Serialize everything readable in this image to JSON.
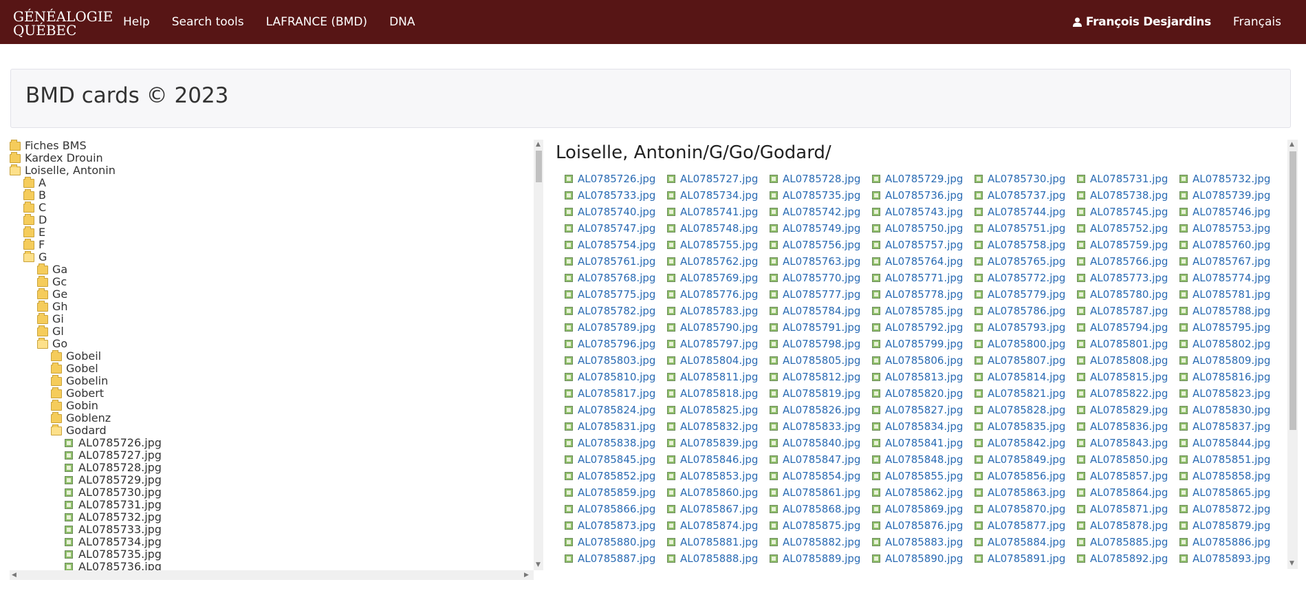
{
  "nav": {
    "logo_line1": "GÉNÉALOGIE",
    "logo_line2": "QUÉBEC",
    "links": [
      "Help",
      "Search tools",
      "LAFRANCE (BMD)",
      "DNA"
    ],
    "user_name": "François Desjardins",
    "user_icon": "user-icon",
    "language": "Français"
  },
  "page_title": "BMD cards © 2023",
  "tree": [
    {
      "label": "Fiches BMS",
      "level": 0,
      "type": "folder",
      "open": false
    },
    {
      "label": "Kardex Drouin",
      "level": 0,
      "type": "folder",
      "open": false
    },
    {
      "label": "Loiselle, Antonin",
      "level": 0,
      "type": "folder",
      "open": true
    },
    {
      "label": "A",
      "level": 1,
      "type": "folder",
      "open": false
    },
    {
      "label": "B",
      "level": 1,
      "type": "folder",
      "open": false
    },
    {
      "label": "C",
      "level": 1,
      "type": "folder",
      "open": false
    },
    {
      "label": "D",
      "level": 1,
      "type": "folder",
      "open": false
    },
    {
      "label": "E",
      "level": 1,
      "type": "folder",
      "open": false
    },
    {
      "label": "F",
      "level": 1,
      "type": "folder",
      "open": false
    },
    {
      "label": "G",
      "level": 1,
      "type": "folder",
      "open": true
    },
    {
      "label": "Ga",
      "level": 2,
      "type": "folder",
      "open": false
    },
    {
      "label": "Gc",
      "level": 2,
      "type": "folder",
      "open": false
    },
    {
      "label": "Ge",
      "level": 2,
      "type": "folder",
      "open": false
    },
    {
      "label": "Gh",
      "level": 2,
      "type": "folder",
      "open": false
    },
    {
      "label": "Gi",
      "level": 2,
      "type": "folder",
      "open": false
    },
    {
      "label": "Gl",
      "level": 2,
      "type": "folder",
      "open": false
    },
    {
      "label": "Go",
      "level": 2,
      "type": "folder",
      "open": true
    },
    {
      "label": "Gobeil",
      "level": 3,
      "type": "folder",
      "open": false
    },
    {
      "label": "Gobel",
      "level": 3,
      "type": "folder",
      "open": false
    },
    {
      "label": "Gobelin",
      "level": 3,
      "type": "folder",
      "open": false
    },
    {
      "label": "Gobert",
      "level": 3,
      "type": "folder",
      "open": false
    },
    {
      "label": "Gobin",
      "level": 3,
      "type": "folder",
      "open": false
    },
    {
      "label": "Goblenz",
      "level": 3,
      "type": "folder",
      "open": false
    },
    {
      "label": "Godard",
      "level": 3,
      "type": "folder",
      "open": true
    },
    {
      "label": "AL0785726.jpg",
      "level": 4,
      "type": "file"
    },
    {
      "label": "AL0785727.jpg",
      "level": 4,
      "type": "file"
    },
    {
      "label": "AL0785728.jpg",
      "level": 4,
      "type": "file"
    },
    {
      "label": "AL0785729.jpg",
      "level": 4,
      "type": "file"
    },
    {
      "label": "AL0785730.jpg",
      "level": 4,
      "type": "file"
    },
    {
      "label": "AL0785731.jpg",
      "level": 4,
      "type": "file"
    },
    {
      "label": "AL0785732.jpg",
      "level": 4,
      "type": "file"
    },
    {
      "label": "AL0785733.jpg",
      "level": 4,
      "type": "file"
    },
    {
      "label": "AL0785734.jpg",
      "level": 4,
      "type": "file"
    },
    {
      "label": "AL0785735.jpg",
      "level": 4,
      "type": "file"
    },
    {
      "label": "AL0785736.jpg",
      "level": 4,
      "type": "file"
    }
  ],
  "folder_title": "Loiselle, Antonin/G/Go/Godard/",
  "files": [
    [
      "AL0785726.jpg",
      "AL0785727.jpg",
      "AL0785728.jpg",
      "AL0785729.jpg",
      "AL0785730.jpg",
      "AL0785731.jpg",
      "AL0785732.jpg"
    ],
    [
      "AL0785733.jpg",
      "AL0785734.jpg",
      "AL0785735.jpg",
      "AL0785736.jpg",
      "AL0785737.jpg",
      "AL0785738.jpg",
      "AL0785739.jpg"
    ],
    [
      "AL0785740.jpg",
      "AL0785741.jpg",
      "AL0785742.jpg",
      "AL0785743.jpg",
      "AL0785744.jpg",
      "AL0785745.jpg",
      "AL0785746.jpg"
    ],
    [
      "AL0785747.jpg",
      "AL0785748.jpg",
      "AL0785749.jpg",
      "AL0785750.jpg",
      "AL0785751.jpg",
      "AL0785752.jpg",
      "AL0785753.jpg"
    ],
    [
      "AL0785754.jpg",
      "AL0785755.jpg",
      "AL0785756.jpg",
      "AL0785757.jpg",
      "AL0785758.jpg",
      "AL0785759.jpg",
      "AL0785760.jpg"
    ],
    [
      "AL0785761.jpg",
      "AL0785762.jpg",
      "AL0785763.jpg",
      "AL0785764.jpg",
      "AL0785765.jpg",
      "AL0785766.jpg",
      "AL0785767.jpg"
    ],
    [
      "AL0785768.jpg",
      "AL0785769.jpg",
      "AL0785770.jpg",
      "AL0785771.jpg",
      "AL0785772.jpg",
      "AL0785773.jpg",
      "AL0785774.jpg"
    ],
    [
      "AL0785775.jpg",
      "AL0785776.jpg",
      "AL0785777.jpg",
      "AL0785778.jpg",
      "AL0785779.jpg",
      "AL0785780.jpg",
      "AL0785781.jpg"
    ],
    [
      "AL0785782.jpg",
      "AL0785783.jpg",
      "AL0785784.jpg",
      "AL0785785.jpg",
      "AL0785786.jpg",
      "AL0785787.jpg",
      "AL0785788.jpg"
    ],
    [
      "AL0785789.jpg",
      "AL0785790.jpg",
      "AL0785791.jpg",
      "AL0785792.jpg",
      "AL0785793.jpg",
      "AL0785794.jpg",
      "AL0785795.jpg"
    ],
    [
      "AL0785796.jpg",
      "AL0785797.jpg",
      "AL0785798.jpg",
      "AL0785799.jpg",
      "AL0785800.jpg",
      "AL0785801.jpg",
      "AL0785802.jpg"
    ],
    [
      "AL0785803.jpg",
      "AL0785804.jpg",
      "AL0785805.jpg",
      "AL0785806.jpg",
      "AL0785807.jpg",
      "AL0785808.jpg",
      "AL0785809.jpg"
    ],
    [
      "AL0785810.jpg",
      "AL0785811.jpg",
      "AL0785812.jpg",
      "AL0785813.jpg",
      "AL0785814.jpg",
      "AL0785815.jpg",
      "AL0785816.jpg"
    ],
    [
      "AL0785817.jpg",
      "AL0785818.jpg",
      "AL0785819.jpg",
      "AL0785820.jpg",
      "AL0785821.jpg",
      "AL0785822.jpg",
      "AL0785823.jpg"
    ],
    [
      "AL0785824.jpg",
      "AL0785825.jpg",
      "AL0785826.jpg",
      "AL0785827.jpg",
      "AL0785828.jpg",
      "AL0785829.jpg",
      "AL0785830.jpg"
    ],
    [
      "AL0785831.jpg",
      "AL0785832.jpg",
      "AL0785833.jpg",
      "AL0785834.jpg",
      "AL0785835.jpg",
      "AL0785836.jpg",
      "AL0785837.jpg"
    ],
    [
      "AL0785838.jpg",
      "AL0785839.jpg",
      "AL0785840.jpg",
      "AL0785841.jpg",
      "AL0785842.jpg",
      "AL0785843.jpg",
      "AL0785844.jpg"
    ],
    [
      "AL0785845.jpg",
      "AL0785846.jpg",
      "AL0785847.jpg",
      "AL0785848.jpg",
      "AL0785849.jpg",
      "AL0785850.jpg",
      "AL0785851.jpg"
    ],
    [
      "AL0785852.jpg",
      "AL0785853.jpg",
      "AL0785854.jpg",
      "AL0785855.jpg",
      "AL0785856.jpg",
      "AL0785857.jpg",
      "AL0785858.jpg"
    ],
    [
      "AL0785859.jpg",
      "AL0785860.jpg",
      "AL0785861.jpg",
      "AL0785862.jpg",
      "AL0785863.jpg",
      "AL0785864.jpg",
      "AL0785865.jpg"
    ],
    [
      "AL0785866.jpg",
      "AL0785867.jpg",
      "AL0785868.jpg",
      "AL0785869.jpg",
      "AL0785870.jpg",
      "AL0785871.jpg",
      "AL0785872.jpg"
    ],
    [
      "AL0785873.jpg",
      "AL0785874.jpg",
      "AL0785875.jpg",
      "AL0785876.jpg",
      "AL0785877.jpg",
      "AL0785878.jpg",
      "AL0785879.jpg"
    ],
    [
      "AL0785880.jpg",
      "AL0785881.jpg",
      "AL0785882.jpg",
      "AL0785883.jpg",
      "AL0785884.jpg",
      "AL0785885.jpg",
      "AL0785886.jpg"
    ],
    [
      "AL0785887.jpg",
      "AL0785888.jpg",
      "AL0785889.jpg",
      "AL0785890.jpg",
      "AL0785891.jpg",
      "AL0785892.jpg",
      "AL0785893.jpg"
    ]
  ],
  "colors": {
    "nav_bg": "#571515",
    "link": "#2a6bb3",
    "folder": "#f5cc5b"
  }
}
